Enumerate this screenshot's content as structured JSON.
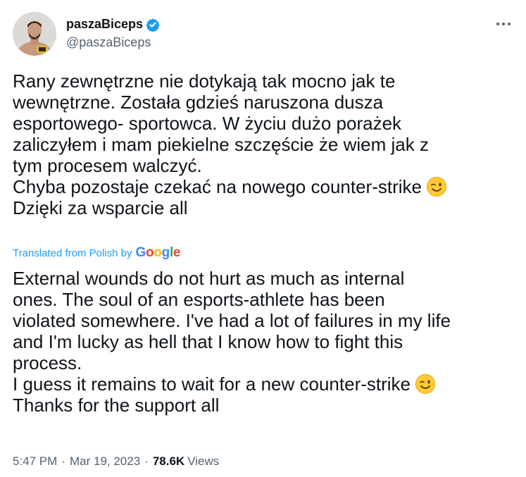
{
  "author": {
    "display_name": "paszaBiceps",
    "handle": "@paszaBiceps",
    "verified_color": "#1d9bf0"
  },
  "original_lines": [
    "Rany zewnętrzne nie dotykają tak mocno jak te",
    "wewnętrzne. Została gdzieś naruszona dusza",
    "esportowego- sportowca. W życiu dużo porażek",
    "zaliczyłem i mam piekielne szczęście że wiem jak z",
    "tym procesem walczyć.",
    "Chyba pozostaje czekać na nowego counter-strike",
    "Dzięki za wsparcie all"
  ],
  "translation_note": {
    "label": "Translated from Polish by",
    "brand": "Google"
  },
  "translated_lines": [
    "External wounds do not hurt as much as internal",
    "ones. The soul of an esports-athlete has been",
    "violated somewhere. I've had a lot of failures in my life",
    "and I'm lucky as hell that I know how to fight this",
    "process.",
    "I guess it remains to wait for a new counter-strike",
    "Thanks for the support all"
  ],
  "emoji": "winking-face",
  "meta": {
    "time": "5:47 PM",
    "separator": "·",
    "date": "Mar 19, 2023",
    "views_count": "78.6K",
    "views_label": "Views"
  },
  "colors": {
    "text": "#0f1419",
    "secondary": "#536471",
    "link": "#1d9bf0"
  }
}
